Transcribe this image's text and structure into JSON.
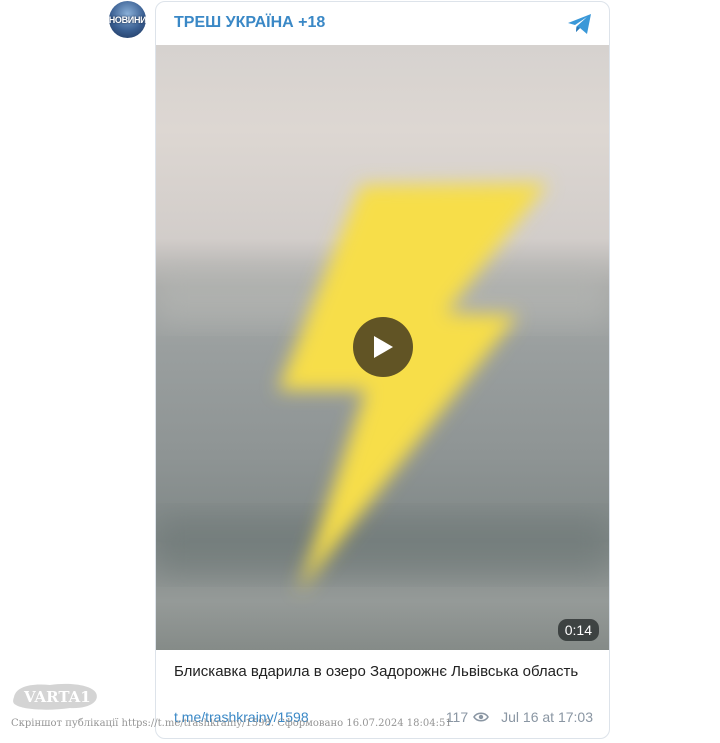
{
  "channel": {
    "avatar_text": "НОВИНИ",
    "title": "ТРЕШ УКРАЇНА +18"
  },
  "video": {
    "duration": "0:14",
    "overlay_icon": "lightning-bolt-icon",
    "bolt_color": "#f7de4a"
  },
  "post": {
    "caption": "Блискавка вдарила в озеро Задорожнє Львівська область",
    "link": "t.me/trashkrainy/1598",
    "views": "117",
    "date": "Jul 16 at 17:03"
  },
  "watermark": {
    "logo": "VARTA1",
    "note": "Скріншот публікації https://t.me/trashkrainy/1598. Сформовано 16.07.2024 18:04:51"
  },
  "colors": {
    "accent": "#3a88c6",
    "meta": "#8a96a3"
  }
}
